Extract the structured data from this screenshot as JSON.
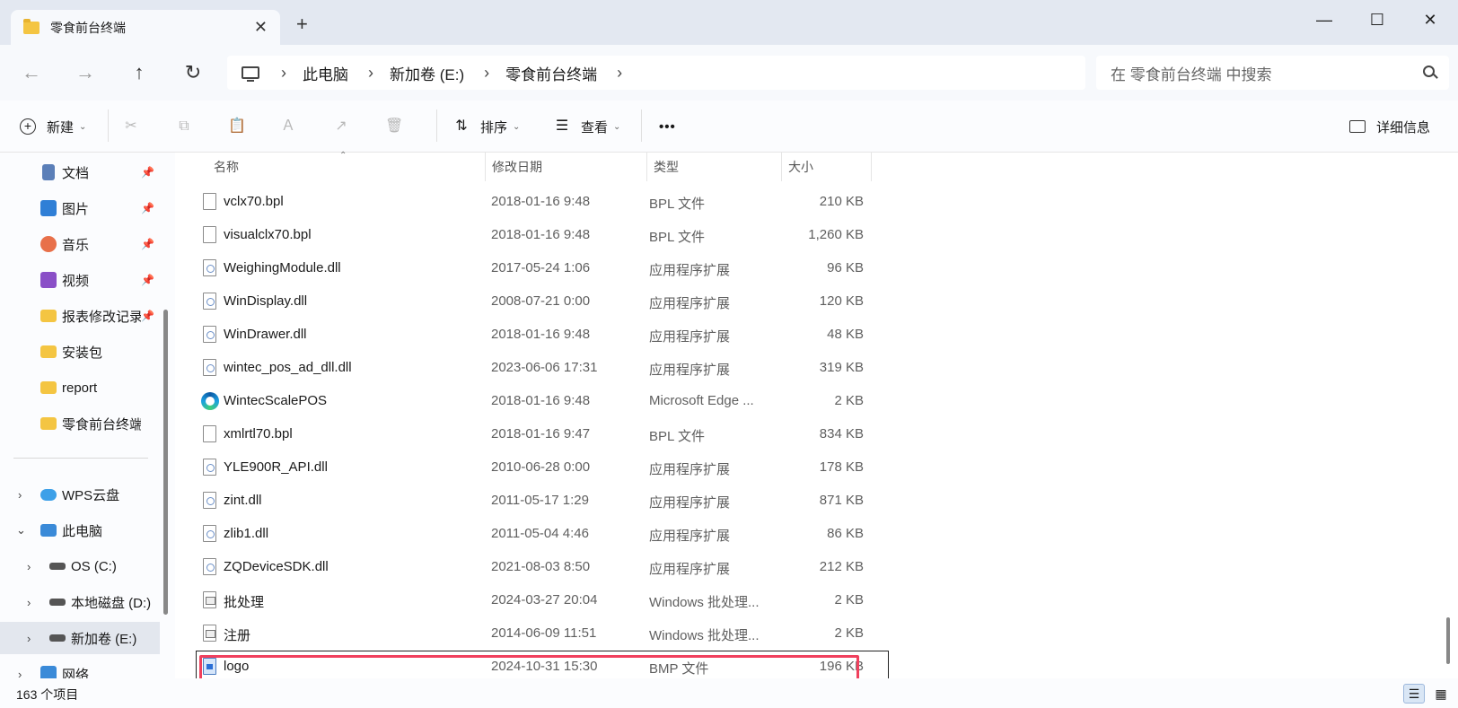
{
  "window": {
    "tab_title": "零食前台终端",
    "tab_close": "✕",
    "tab_add": "+",
    "minimize": "—",
    "maximize": "☐",
    "close": "✕"
  },
  "nav": {
    "back": "←",
    "forward": "→",
    "up": "↑",
    "refresh": "↻"
  },
  "address": {
    "crumbs": [
      "此电脑",
      "新加卷 (E:)",
      "零食前台终端"
    ],
    "separator": "›"
  },
  "search": {
    "placeholder": "在 零食前台终端 中搜索"
  },
  "toolbar": {
    "new_label": "新建",
    "sort_label": "排序",
    "view_label": "查看",
    "more_label": "•••",
    "details_label": "详细信息"
  },
  "sidebar": {
    "quick": [
      {
        "label": "文档",
        "icon": "document-icon",
        "color": "#5b7fb8"
      },
      {
        "label": "图片",
        "icon": "picture-icon",
        "color": "#2f7fd6"
      },
      {
        "label": "音乐",
        "icon": "music-icon",
        "color": "#e8704a"
      },
      {
        "label": "视频",
        "icon": "video-icon",
        "color": "#8a4fc7"
      },
      {
        "label": "报表修改记录",
        "icon": "folder-icon",
        "color": "#f4c542"
      },
      {
        "label": "安装包",
        "icon": "folder-icon",
        "color": "#f4c542"
      },
      {
        "label": "report",
        "icon": "folder-icon",
        "color": "#f4c542"
      },
      {
        "label": "零食前台终端",
        "icon": "folder-icon",
        "color": "#f4c542"
      }
    ],
    "tree": [
      {
        "label": "WPS云盘",
        "chevron": "›"
      },
      {
        "label": "此电脑",
        "chevron": "⌄"
      },
      {
        "label": "OS (C:)",
        "chevron": "›"
      },
      {
        "label": "本地磁盘 (D:)",
        "chevron": "›"
      },
      {
        "label": "新加卷 (E:)",
        "chevron": "›"
      },
      {
        "label": "网络",
        "chevron": "›"
      }
    ]
  },
  "columns": {
    "name": "名称",
    "date": "修改日期",
    "type": "类型",
    "size": "大小"
  },
  "files": [
    {
      "name": "vclx70.bpl",
      "date": "2018-01-16 9:48",
      "type": "BPL 文件",
      "size": "210 KB",
      "kind": "plain"
    },
    {
      "name": "visualclx70.bpl",
      "date": "2018-01-16 9:48",
      "type": "BPL 文件",
      "size": "1,260 KB",
      "kind": "plain"
    },
    {
      "name": "WeighingModule.dll",
      "date": "2017-05-24 1:06",
      "type": "应用程序扩展",
      "size": "96 KB",
      "kind": "dll"
    },
    {
      "name": "WinDisplay.dll",
      "date": "2008-07-21 0:00",
      "type": "应用程序扩展",
      "size": "120 KB",
      "kind": "dll"
    },
    {
      "name": "WinDrawer.dll",
      "date": "2018-01-16 9:48",
      "type": "应用程序扩展",
      "size": "48 KB",
      "kind": "dll"
    },
    {
      "name": "wintec_pos_ad_dll.dll",
      "date": "2023-06-06 17:31",
      "type": "应用程序扩展",
      "size": "319 KB",
      "kind": "dll"
    },
    {
      "name": "WintecScalePOS",
      "date": "2018-01-16 9:48",
      "type": "Microsoft Edge ...",
      "size": "2 KB",
      "kind": "edge"
    },
    {
      "name": "xmlrtl70.bpl",
      "date": "2018-01-16 9:47",
      "type": "BPL 文件",
      "size": "834 KB",
      "kind": "plain"
    },
    {
      "name": "YLE900R_API.dll",
      "date": "2010-06-28 0:00",
      "type": "应用程序扩展",
      "size": "178 KB",
      "kind": "dll"
    },
    {
      "name": "zint.dll",
      "date": "2011-05-17 1:29",
      "type": "应用程序扩展",
      "size": "871 KB",
      "kind": "dll"
    },
    {
      "name": "zlib1.dll",
      "date": "2011-05-04 4:46",
      "type": "应用程序扩展",
      "size": "86 KB",
      "kind": "dll"
    },
    {
      "name": "ZQDeviceSDK.dll",
      "date": "2021-08-03 8:50",
      "type": "应用程序扩展",
      "size": "212 KB",
      "kind": "dll"
    },
    {
      "name": "批处理",
      "date": "2024-03-27 20:04",
      "type": "Windows 批处理...",
      "size": "2 KB",
      "kind": "bat"
    },
    {
      "name": "注册",
      "date": "2014-06-09 11:51",
      "type": "Windows 批处理...",
      "size": "2 KB",
      "kind": "bat"
    },
    {
      "name": "logo",
      "date": "2024-10-31 15:30",
      "type": "BMP 文件",
      "size": "196 KB",
      "kind": "bmp"
    }
  ],
  "status": {
    "count": "163 个项目"
  },
  "colors": {
    "highlight": "#f0405d",
    "accent": "#2f7fd6"
  }
}
